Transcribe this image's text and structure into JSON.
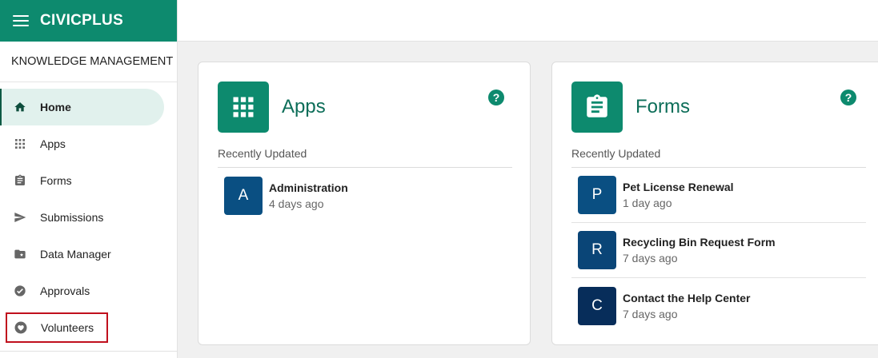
{
  "brand": {
    "name": "CIVICPLUS"
  },
  "breadcrumb": {
    "label": "KNOWLEDGE MANAGEMENT",
    "chevron": "›"
  },
  "sidebar": {
    "items": [
      {
        "label": "Home",
        "icon": "home-icon"
      },
      {
        "label": "Apps",
        "icon": "grid-icon"
      },
      {
        "label": "Forms",
        "icon": "clipboard-icon"
      },
      {
        "label": "Submissions",
        "icon": "send-icon"
      },
      {
        "label": "Data Manager",
        "icon": "folder-star-icon"
      },
      {
        "label": "Approvals",
        "icon": "check-circle-icon"
      },
      {
        "label": "Volunteers",
        "icon": "heart-hand-icon"
      }
    ]
  },
  "apps_card": {
    "title": "Apps",
    "help": "?",
    "recent_label": "Recently Updated",
    "items": [
      {
        "initial": "A",
        "name": "Administration",
        "time": "4 days ago",
        "color": "#0a4f82"
      }
    ]
  },
  "forms_card": {
    "title": "Forms",
    "help": "?",
    "recent_label": "Recently Updated",
    "items": [
      {
        "initial": "P",
        "name": "Pet License Renewal",
        "time": "1 day ago",
        "color": "#0a4f82"
      },
      {
        "initial": "R",
        "name": "Recycling Bin Request Form",
        "time": "7 days ago",
        "color": "#0a4577"
      },
      {
        "initial": "C",
        "name": "Contact the Help Center",
        "time": "7 days ago",
        "color": "#072d5a"
      }
    ]
  },
  "colors": {
    "brand": "#0d8a6e",
    "accent_dark": "#0d6e59",
    "highlight": "#c0101d"
  }
}
